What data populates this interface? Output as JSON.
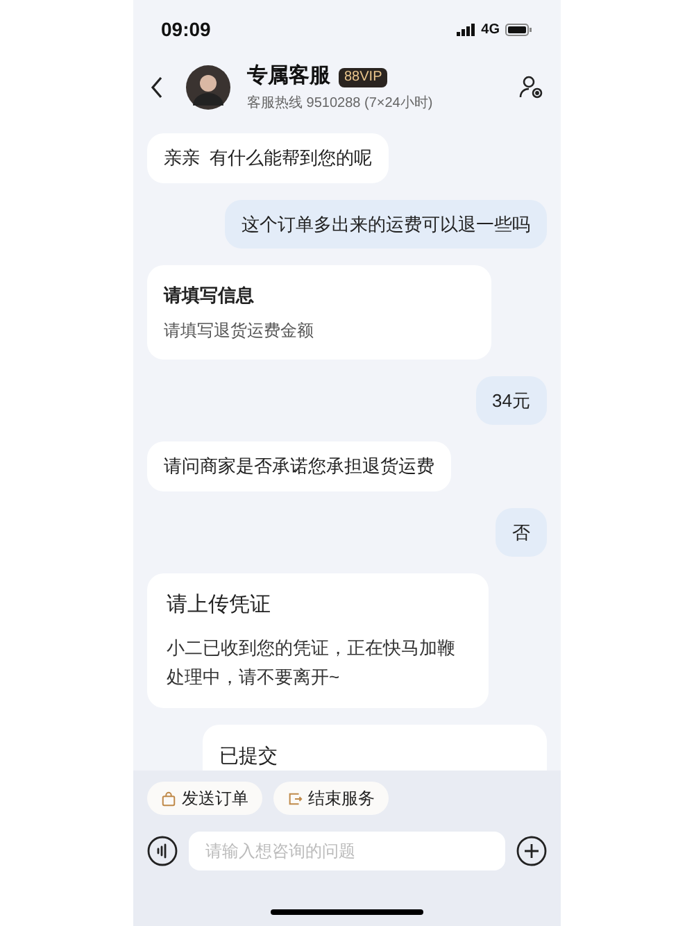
{
  "status_bar": {
    "time": "09:09",
    "network": "4G"
  },
  "header": {
    "title": "专属客服",
    "badge": "88VIP",
    "subtitle": "客服热线 9510288 (7×24小时)"
  },
  "messages": [
    {
      "kind": "agent_text",
      "text": "亲亲  有什么能帮到您的呢"
    },
    {
      "kind": "user_text",
      "text": "这个订单多出来的运费可以退一些吗"
    },
    {
      "kind": "agent_card",
      "title": "请填写信息",
      "text": "请填写退货运费金额"
    },
    {
      "kind": "user_text",
      "text": "34元"
    },
    {
      "kind": "agent_text",
      "text": "请问商家是否承诺您承担退货运费"
    },
    {
      "kind": "user_text",
      "text": "否"
    },
    {
      "kind": "agent_card_large",
      "title": "请上传凭证",
      "text": "小二已收到您的凭证，正在快马加鞭处理中，请不要离开~"
    },
    {
      "kind": "user_card",
      "title": "已提交"
    }
  ],
  "quick_actions": [
    {
      "label": "发送订单",
      "kind": "order"
    },
    {
      "label": "结束服务",
      "kind": "end"
    }
  ],
  "input": {
    "placeholder": "请输入想咨询的问题"
  }
}
